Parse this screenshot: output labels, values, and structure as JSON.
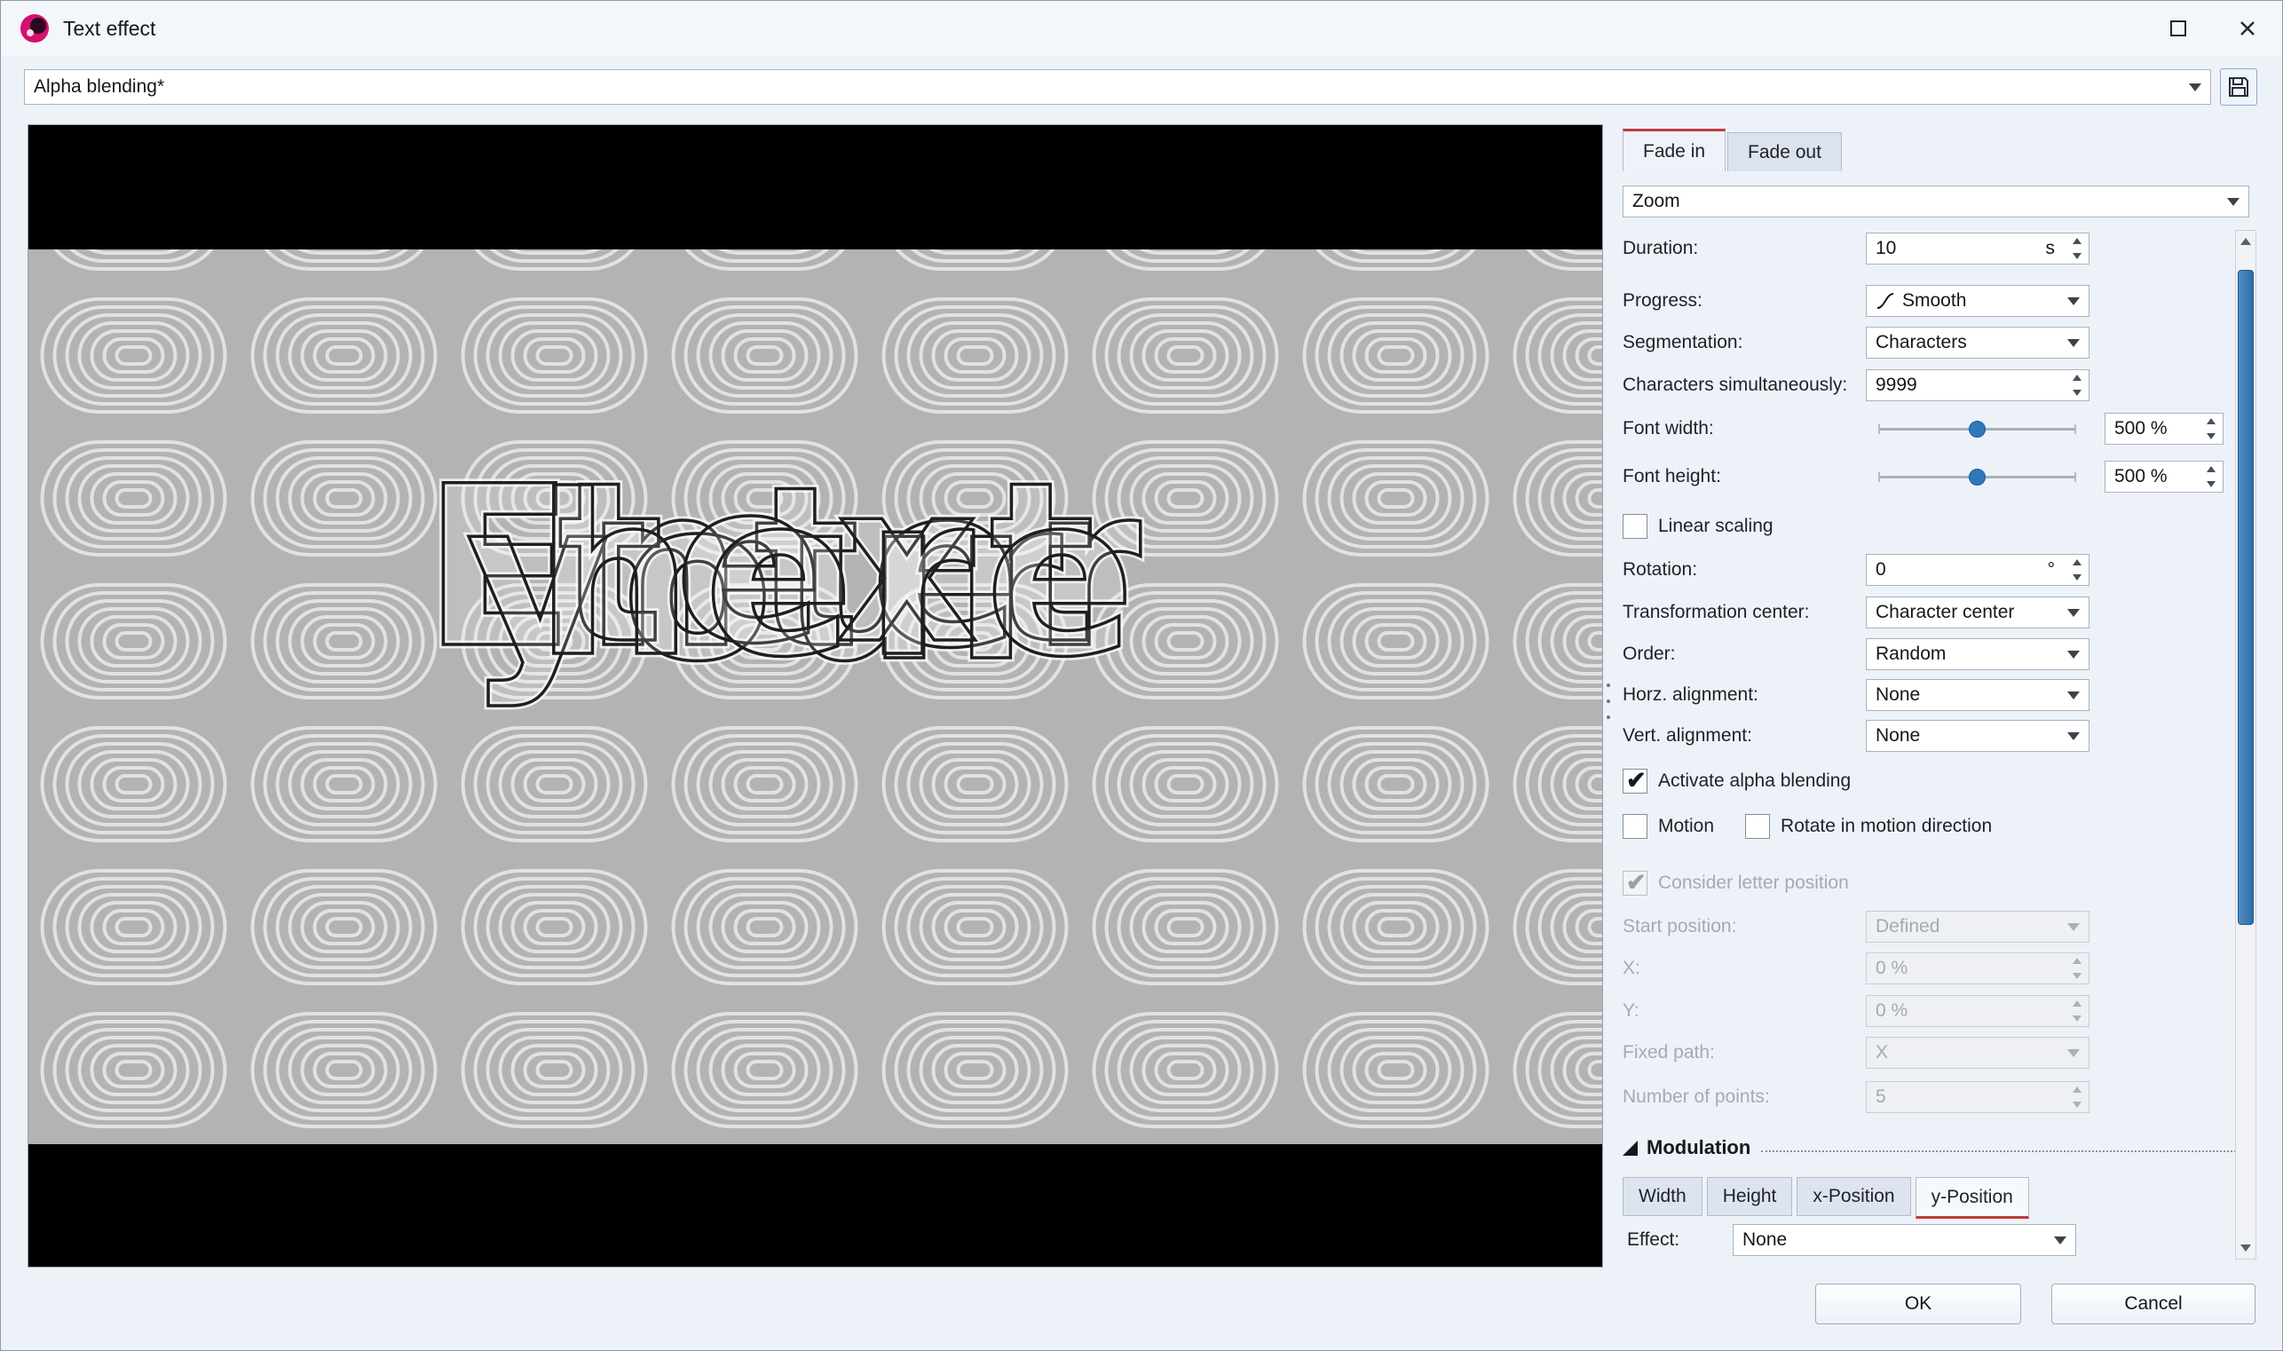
{
  "window": {
    "title": "Text effect"
  },
  "preset": {
    "value": "Alpha blending*"
  },
  "preview": {
    "words": [
      "Enter",
      "your",
      "text",
      "here"
    ]
  },
  "panel": {
    "tabs": {
      "fade_in": "Fade in",
      "fade_out": "Fade out"
    },
    "effect_type": "Zoom",
    "rows": {
      "duration": {
        "label": "Duration:",
        "value": "10",
        "unit": "s"
      },
      "progress": {
        "label": "Progress:",
        "value": "Smooth"
      },
      "segmentation": {
        "label": "Segmentation:",
        "value": "Characters"
      },
      "chars_simultaneously": {
        "label": "Characters simultaneously:",
        "value": "9999"
      },
      "font_width": {
        "label": "Font width:",
        "value": "500 %",
        "slider_percent": 50
      },
      "font_height": {
        "label": "Font height:",
        "value": "500 %",
        "slider_percent": 50
      },
      "linear_scaling": {
        "label": "Linear scaling",
        "checked": false
      },
      "rotation": {
        "label": "Rotation:",
        "value": "0",
        "unit": "°"
      },
      "transformation_center": {
        "label": "Transformation center:",
        "value": "Character center"
      },
      "order": {
        "label": "Order:",
        "value": "Random"
      },
      "horz_alignment": {
        "label": "Horz. alignment:",
        "value": "None"
      },
      "vert_alignment": {
        "label": "Vert. alignment:",
        "value": "None"
      },
      "activate_alpha": {
        "label": "Activate alpha blending",
        "checked": true
      },
      "motion": {
        "label": "Motion",
        "checked": false
      },
      "rotate_motion": {
        "label": "Rotate in motion direction",
        "checked": false
      },
      "consider_letter": {
        "label": "Consider letter position",
        "checked": true,
        "disabled": true
      },
      "start_position": {
        "label": "Start position:",
        "value": "Defined",
        "disabled": true
      },
      "x": {
        "label": "X:",
        "value": "0 %",
        "disabled": true
      },
      "y": {
        "label": "Y:",
        "value": "0 %",
        "disabled": true
      },
      "fixed_path": {
        "label": "Fixed path:",
        "value": "X",
        "disabled": true
      },
      "number_of_points": {
        "label": "Number of points:",
        "value": "5",
        "disabled": true
      }
    },
    "modulation": {
      "header": "Modulation",
      "tabs": [
        "Width",
        "Height",
        "x-Position",
        "y-Position"
      ],
      "active_tab": "y-Position",
      "effect_label": "Effect:",
      "effect_value": "None"
    }
  },
  "footer": {
    "ok": "OK",
    "cancel": "Cancel"
  },
  "colors": {
    "accent_red": "#c23b3b",
    "slider_blue": "#2e78bb",
    "dialog_bg": "#edf2f9",
    "preview_bar": "#000000",
    "pattern_bg": "#b3b3b3",
    "pattern_ring": "#e2e2e2"
  }
}
